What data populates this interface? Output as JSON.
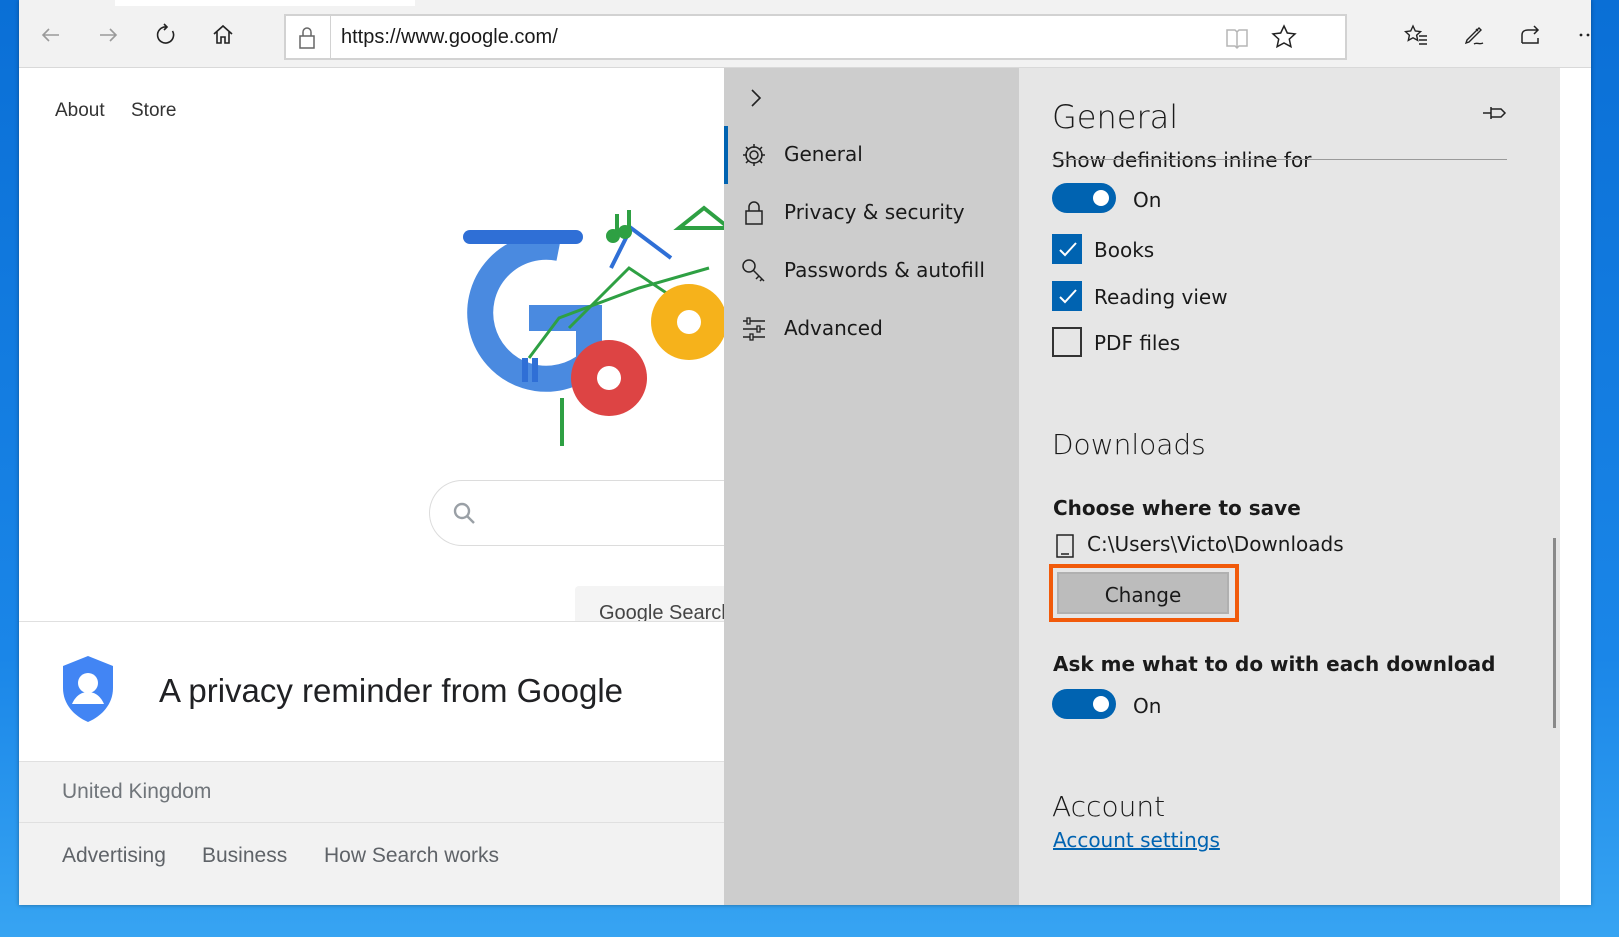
{
  "browser": {
    "url": "https://www.google.com/",
    "icons": [
      "back-icon",
      "forward-icon",
      "refresh-icon",
      "home-icon",
      "lock-icon",
      "reading-view-icon",
      "favorite-star-icon",
      "favorites-icon",
      "pen-icon",
      "share-icon",
      "more-icon"
    ]
  },
  "google": {
    "top_links": [
      "About",
      "Store"
    ],
    "search_button": "Google Search",
    "privacy_title": "A privacy reminder from Google",
    "country": "United Kingdom",
    "footer_links": [
      "Advertising",
      "Business",
      "How Search works"
    ]
  },
  "settings_nav": {
    "items": [
      {
        "label": "General",
        "icon": "gear-icon",
        "active": true
      },
      {
        "label": "Privacy & security",
        "icon": "lock-icon"
      },
      {
        "label": "Passwords & autofill",
        "icon": "key-icon"
      },
      {
        "label": "Advanced",
        "icon": "sliders-icon"
      }
    ]
  },
  "settings": {
    "title": "General",
    "clipped_heading": "Show definitions inline for",
    "definitions_toggle": "On",
    "checkboxes": [
      {
        "label": "Books",
        "checked": true
      },
      {
        "label": "Reading view",
        "checked": true
      },
      {
        "label": "PDF files",
        "checked": false
      }
    ],
    "downloads_title": "Downloads",
    "choose_label": "Choose where to save",
    "download_path": "C:\\Users\\Victo\\Downloads",
    "change_button": "Change",
    "ask_label": "Ask me what to do with each download",
    "ask_toggle": "On",
    "account_title": "Account",
    "account_link": "Account settings"
  },
  "colors": {
    "accent": "#0063b1",
    "highlight": "#f15a0a",
    "nav_bg": "#cdcdcd",
    "pane_bg": "#e6e6e6"
  }
}
